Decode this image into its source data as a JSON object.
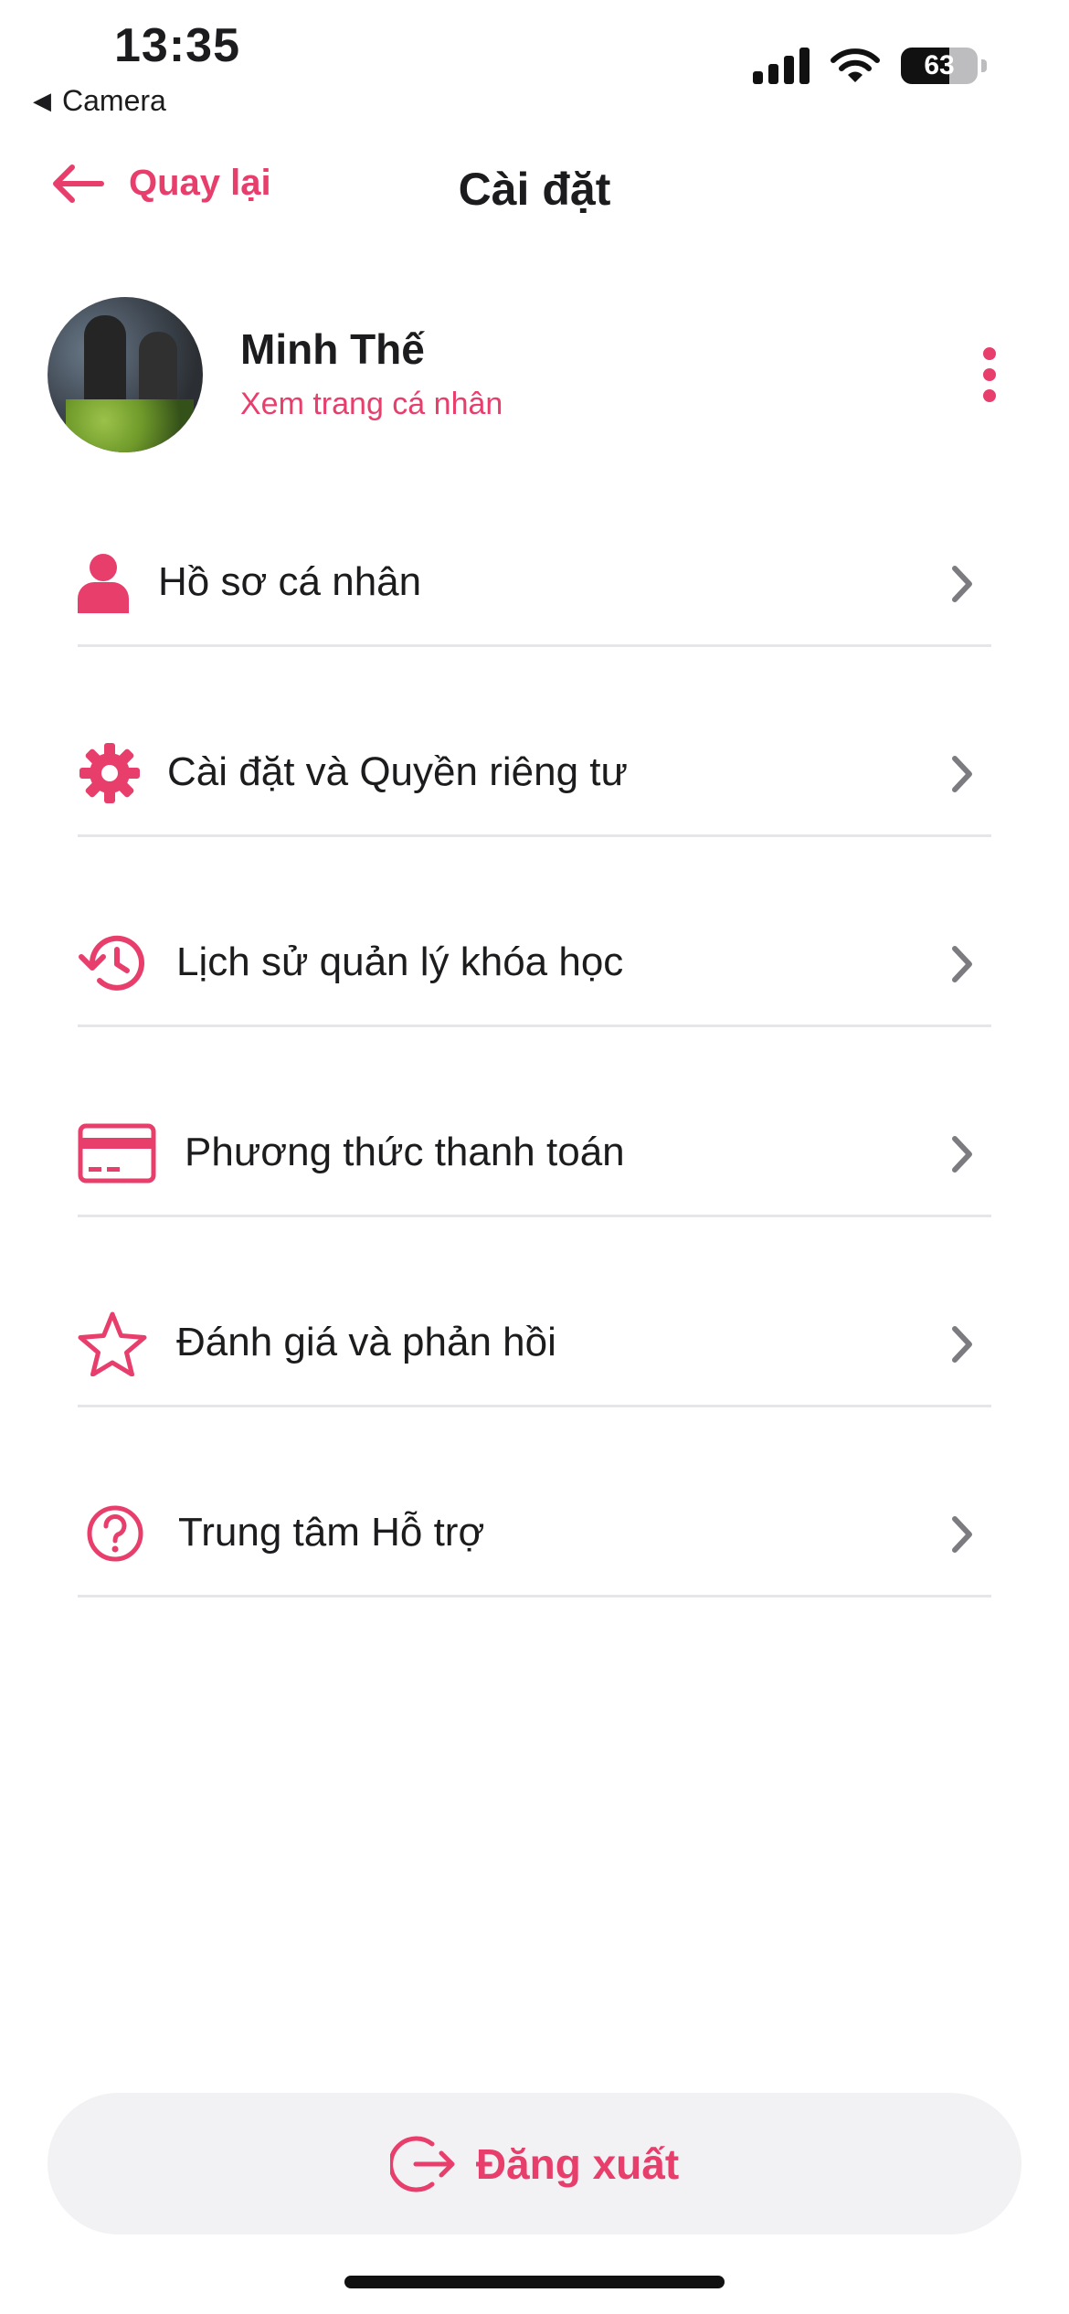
{
  "status_bar": {
    "time": "13:35",
    "back_app": "Camera",
    "battery_text": "63",
    "battery_level_percent": 63
  },
  "header": {
    "back_label": "Quay lại",
    "title": "Cài đặt"
  },
  "profile": {
    "name": "Minh Thế",
    "link": "Xem trang cá nhân"
  },
  "menu": {
    "items": [
      {
        "icon": "person-icon",
        "label": "Hồ sơ cá nhân"
      },
      {
        "icon": "gear-icon",
        "label": "Cài đặt và Quyền riêng tư"
      },
      {
        "icon": "history-icon",
        "label": "Lịch sử quản lý khóa học"
      },
      {
        "icon": "credit-card-icon",
        "label": "Phương thức thanh toán"
      },
      {
        "icon": "star-icon",
        "label": "Đánh giá và phản hồi"
      },
      {
        "icon": "help-circle-icon",
        "label": "Trung tâm Hỗ trợ"
      }
    ]
  },
  "logout": {
    "label": "Đăng xuất",
    "icon": "logout-icon"
  },
  "colors": {
    "accent": "#e83e6c",
    "text": "#1c1c1e",
    "divider": "#e5e5ea",
    "chevron": "#8e8e93"
  }
}
